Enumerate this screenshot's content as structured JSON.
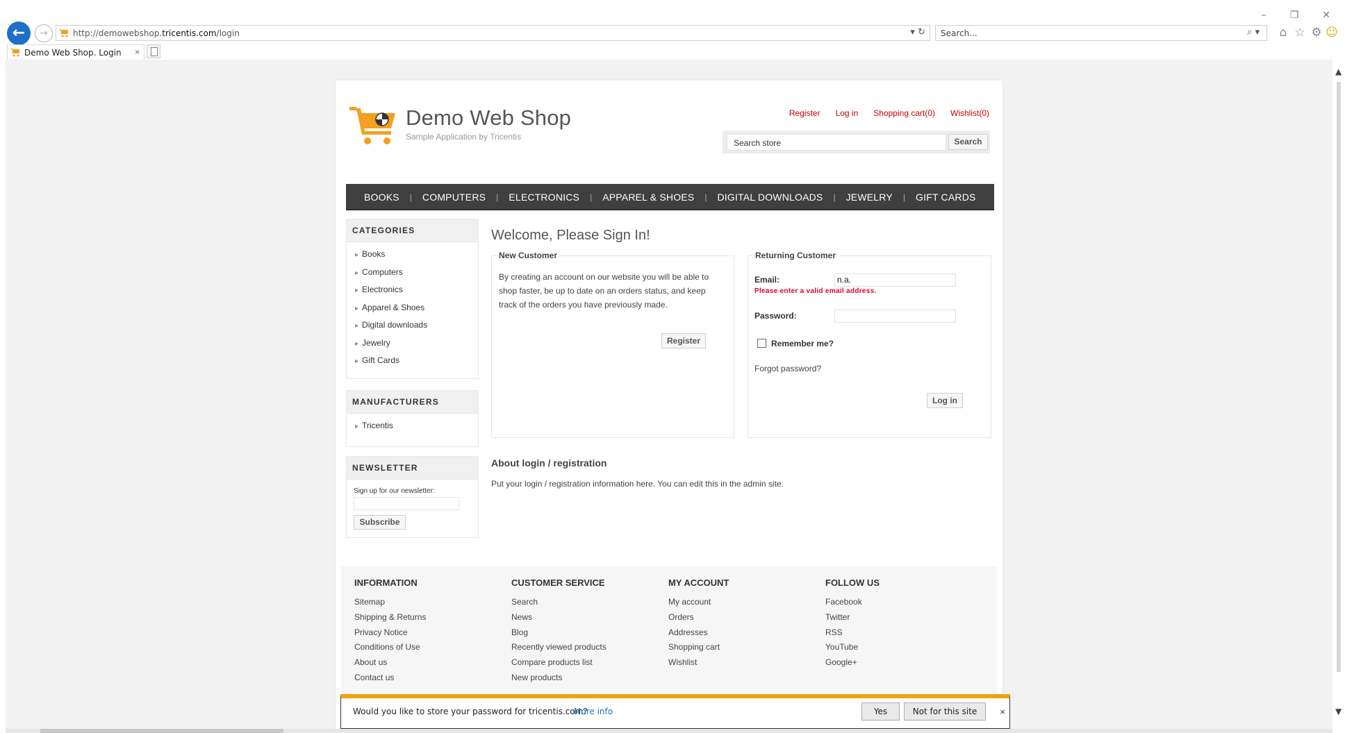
{
  "browser": {
    "url_prefix": "http://demowebshop.",
    "url_domain": "tricentis.com",
    "url_path": "/login",
    "search_placeholder": "Search...",
    "tab_title": "Demo Web Shop. Login",
    "tab_close": "×"
  },
  "header": {
    "title": "Demo Web Shop",
    "subtitle": "Sample Application by Tricentis",
    "links": {
      "register": "Register",
      "login": "Log in",
      "cart": "Shopping cart(0)",
      "wishlist": "Wishlist(0)"
    },
    "search_value": "Search store",
    "search_button": "Search"
  },
  "menu": [
    "BOOKS",
    "COMPUTERS",
    "ELECTRONICS",
    "APPAREL & SHOES",
    "DIGITAL DOWNLOADS",
    "JEWELRY",
    "GIFT CARDS"
  ],
  "categories": {
    "title": "CATEGORIES",
    "items": [
      "Books",
      "Computers",
      "Electronics",
      "Apparel & Shoes",
      "Digital downloads",
      "Jewelry",
      "Gift Cards"
    ]
  },
  "manufacturers": {
    "title": "MANUFACTURERS",
    "items": [
      "Tricentis"
    ]
  },
  "newsletter": {
    "title": "NEWSLETTER",
    "label": "Sign up for our newsletter:",
    "button": "Subscribe"
  },
  "login": {
    "page_title": "Welcome, Please Sign In!",
    "new_customer": {
      "legend": "New Customer",
      "text": "By creating an account on our website you will be able to shop faster, be up to date on an orders status, and keep track of the orders you have previously made.",
      "button": "Register"
    },
    "returning": {
      "legend": "Returning Customer",
      "email_label": "Email:",
      "email_value": "n.a.",
      "email_error": "Please enter a valid email address.",
      "password_label": "Password:",
      "remember_label": "Remember me?",
      "forgot": "Forgot password?",
      "button": "Log in"
    },
    "about_title": "About login / registration",
    "about_text": "Put your login / registration information here. You can edit this in the admin site."
  },
  "footer": {
    "columns": [
      {
        "title": "INFORMATION",
        "links": [
          "Sitemap",
          "Shipping & Returns",
          "Privacy Notice",
          "Conditions of Use",
          "About us",
          "Contact us"
        ]
      },
      {
        "title": "CUSTOMER SERVICE",
        "links": [
          "Search",
          "News",
          "Blog",
          "Recently viewed products",
          "Compare products list",
          "New products"
        ]
      },
      {
        "title": "MY ACCOUNT",
        "links": [
          "My account",
          "Orders",
          "Addresses",
          "Shopping cart",
          "Wishlist"
        ]
      },
      {
        "title": "FOLLOW US",
        "links": [
          "Facebook",
          "Twitter",
          "RSS",
          "YouTube",
          "Google+"
        ]
      }
    ]
  },
  "password_bar": {
    "question": "Would you like to store your password for tricentis.com?",
    "more_info": "More info",
    "yes": "Yes",
    "no": "Not for this site",
    "close": "×"
  },
  "colors": {
    "accent_link": "#cc0000",
    "menu_bg": "#3f3f3f",
    "error": "#e4002b",
    "browser_accent": "#1e6fc6",
    "notification_bar": "#f0a30a"
  }
}
